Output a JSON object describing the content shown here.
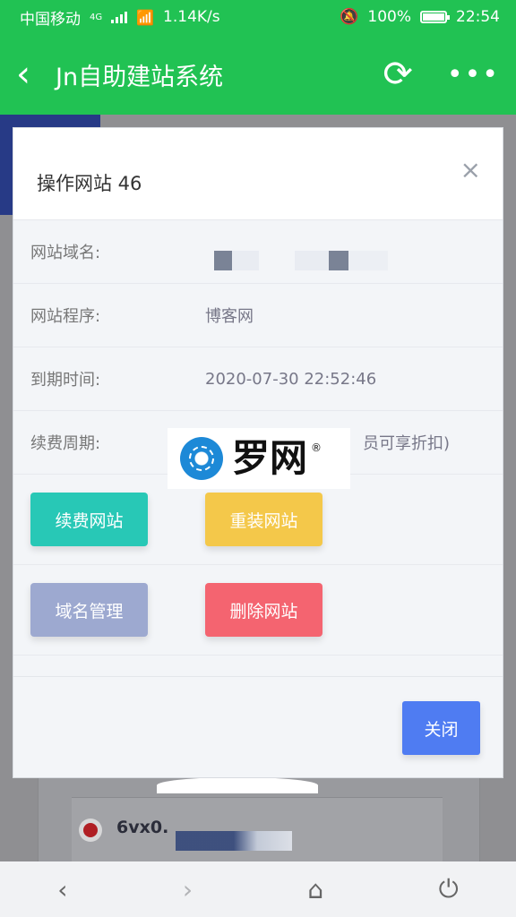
{
  "status": {
    "carrier": "中国移动",
    "network": "4G",
    "speed": "1.14K/s",
    "battery": "100%",
    "time": "22:54"
  },
  "appbar": {
    "title": "Jn自助建站系统",
    "back_icon": "‹",
    "refresh_icon": "⟳",
    "more_icon": "•••"
  },
  "modal": {
    "title": "操作网站 46",
    "close_icon": "×",
    "fields": [
      {
        "label": "网站域名:",
        "value": ""
      },
      {
        "label": "网站程序:",
        "value": "博客网"
      },
      {
        "label": "到期时间:",
        "value": "2020-07-30 22:52:46"
      },
      {
        "label": "续费周期:",
        "value": "员可享折扣)"
      }
    ],
    "buttons": {
      "renew": "续费网站",
      "reinstall": "重装网站",
      "domain": "域名管理",
      "delete": "删除网站",
      "close": "关闭"
    }
  },
  "watermark": {
    "text": "罗网",
    "reg": "®"
  },
  "background": {
    "item_text": "6vx0."
  },
  "navbar": {
    "back_icon": "‹",
    "forward_icon": "›",
    "home_icon": "⌂",
    "power_icon": "⏻"
  }
}
